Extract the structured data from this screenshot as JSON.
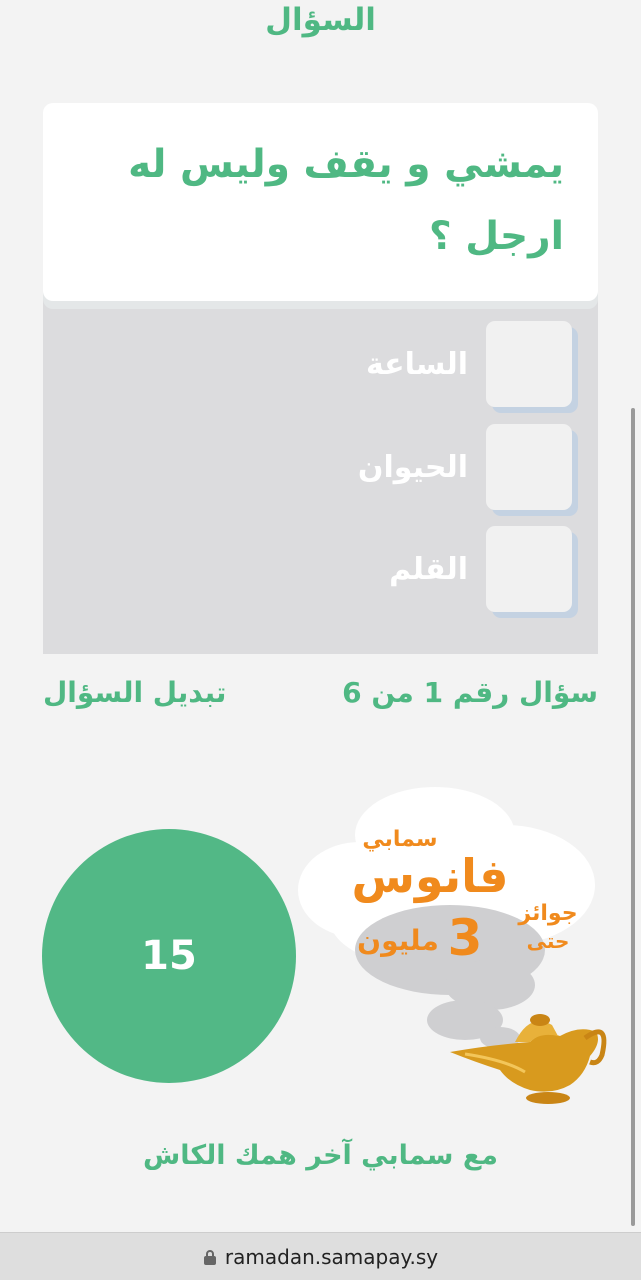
{
  "header": {
    "title": "السؤال"
  },
  "question": {
    "text": "يمشي و يقف وليس له ارجل ؟"
  },
  "options": [
    {
      "label": "الساعة"
    },
    {
      "label": "الحيوان"
    },
    {
      "label": "القلم"
    }
  ],
  "meta": {
    "counter": "سؤال رقم 1 من 6",
    "change_question": "تبديل السؤال"
  },
  "timer": {
    "value": "15"
  },
  "promo": {
    "brand": "سمابي",
    "main": "فانوس",
    "prizes": "جوائز",
    "until": "حتى",
    "amount": "3",
    "million": "مليون"
  },
  "footer": {
    "text": "مع سمابي آخر همك الكاش"
  },
  "browser": {
    "url": "ramadan.samapay.sy"
  },
  "colors": {
    "accent": "#4fb883",
    "panel": "#dcdcde",
    "promo_orange": "#f08a1d"
  },
  "icons": [
    "lock-icon",
    "magic-lamp-icon",
    "cloud-icon"
  ]
}
